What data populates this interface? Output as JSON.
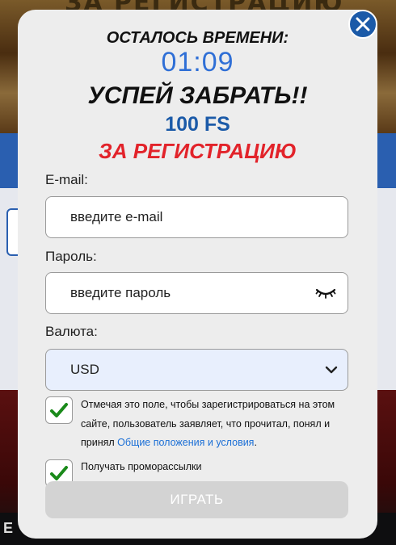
{
  "background": {
    "banner_text": "ЗА РЕГИСТРАЦИЮ",
    "bottom_label": "Е"
  },
  "modal": {
    "timer_label": "ОСТАЛОСЬ ВРЕМЕНИ:",
    "timer_value": "01:09",
    "headline": "УСПЕЙ ЗАБРАТЬ!!",
    "bonus": "100 FS",
    "bonus_sub": "ЗА РЕГИСТРАЦИЮ",
    "close_icon": "close-icon",
    "accent_color": "#1b5aa8",
    "timer_color": "#2f6fd6",
    "highlight_color": "#e2232a"
  },
  "form": {
    "email_label": "E-mail:",
    "email_placeholder": "введите e-mail",
    "password_label": "Пароль:",
    "password_placeholder": "введите пароль",
    "password_icon": "eye-closed-icon",
    "currency_label": "Валюта:",
    "currency_value": "USD",
    "terms_checked": true,
    "terms_text": "Отмечая это поле, чтобы зарегистрироваться на этом сайте, пользователь заявляет, что прочитал, понял и принял ",
    "terms_link": "Общие положения и условия",
    "terms_end": ".",
    "promo_checked": true,
    "promo_text": "Получать проморассылки",
    "submit_label": "ИГРАТЬ"
  }
}
